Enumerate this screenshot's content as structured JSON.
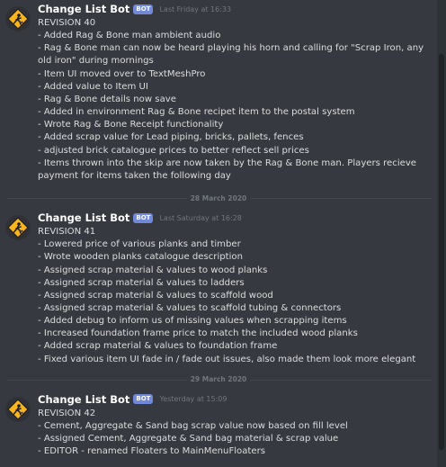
{
  "colors": {
    "background": "#36393f",
    "bot_badge": "#7289da",
    "username": "#ffffff",
    "text": "#dcddde",
    "muted": "#72767d"
  },
  "avatar_icon": "construction-worker-warning-sign-icon",
  "messages": [
    {
      "username": "Change List Bot",
      "badge": "BOT",
      "timestamp": "Last Friday at 16:33",
      "lines": [
        "REVISION 40",
        "- Added Rag & Bone man ambient audio",
        "- Rag & Bone man can now be heard playing his horn and calling for \"Scrap Iron, any old iron\" during mornings",
        "- Item UI moved over to TextMeshPro",
        "- Added value to Item UI",
        "- Rag & Bone details now save",
        "- Added in environment Rag & Bone recipet item to the postal system",
        "- Wrote Rag & Bone Receipt functionality",
        "- Added scrap value for Lead piping, bricks, pallets, fences",
        "- adjusted brick catalogue prices to better reflect sell prices",
        "- Items thrown into the skip are now taken by the Rag & Bone man. Players recieve payment for items taken the following day"
      ]
    },
    {
      "username": "Change List Bot",
      "badge": "BOT",
      "timestamp": "Last Saturday at 16:28",
      "lines": [
        "REVISION 41",
        "- Lowered price of various planks and timber",
        "- Wrote wooden planks catalogue description",
        "- Assigned scrap material & values to wood planks",
        "- Assigned scrap material & values to ladders",
        "- Assigned scrap material & values to scaffold wood",
        "- Assigned scrap material & values to scaffold tubing & connectors",
        "- Added debug to inform us of missing values when scrapping items",
        "- Increased foundation frame price to match the included wood planks",
        "- Added scrap material & values to foundation frame",
        "- Fixed various item UI fade in / fade out issues, also made them look more elegant"
      ]
    },
    {
      "username": "Change List Bot",
      "badge": "BOT",
      "timestamp": "Yesterday at 15:09",
      "lines": [
        "REVISION 42",
        "- Cement, Aggregate & Sand bag scrap value now based on fill level",
        "- Assigned Cement, Aggregate & Sand bag material & scrap value",
        "- EDITOR - renamed Floaters to MainMenuFloaters"
      ]
    }
  ],
  "dividers": [
    "28 March 2020",
    "29 March 2020"
  ]
}
